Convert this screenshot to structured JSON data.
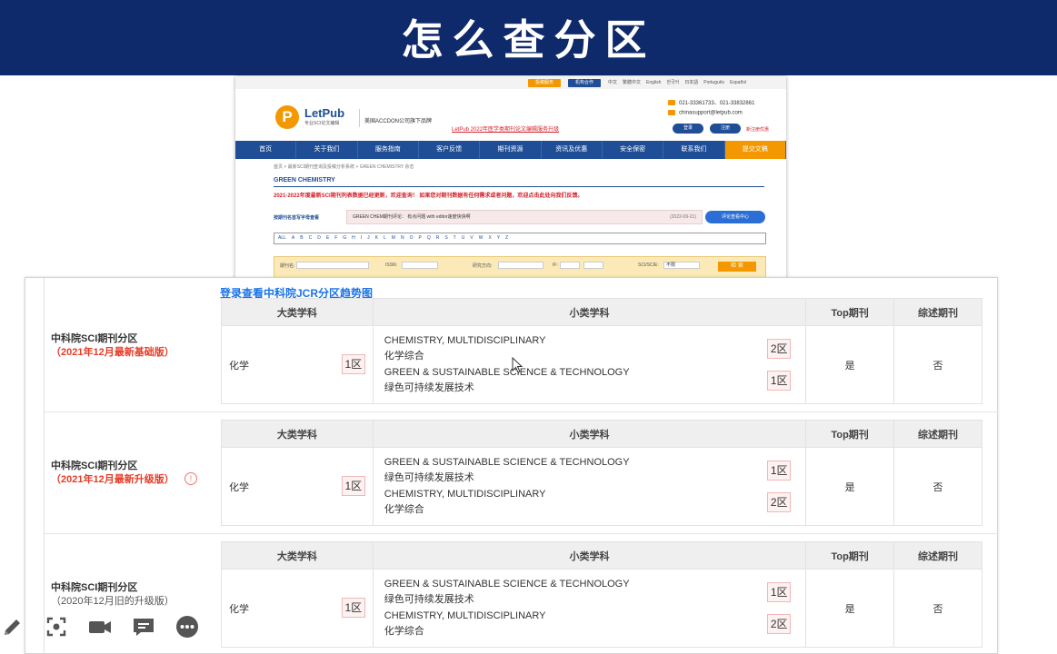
{
  "slide": {
    "title": "怎么查分区"
  },
  "letpub": {
    "top_buttons": [
      "投稿服务",
      "机构合作"
    ],
    "languages": [
      "中文",
      "繁體中文",
      "English",
      "한국어",
      "日本語",
      "Português",
      "Español"
    ],
    "logo": {
      "letter": "P",
      "name": "LetPub",
      "tagline": "专业SCI论文编辑"
    },
    "parent_company": "美国ACCDON公司旗下品牌",
    "notice": "LetPub 2022年医学类期刊论文编辑服务升级",
    "phone": "021-33361733、021-33832861",
    "email": "chinasupport@letpub.com",
    "login": "登录",
    "register": "注册",
    "new_user": "新注册优惠",
    "nav": [
      "首页",
      "关于我们",
      "服务指南",
      "客户反馈",
      "期刊资源",
      "资讯及优惠",
      "安全保密",
      "联系我们",
      "提交文稿"
    ],
    "breadcrumb": "首页 > 最新SCI期刊查询及投稿分析系统 > GREEN CHEMISTRY 杂志",
    "journal_name": "GREEN CHEMISTRY",
    "update_message": "2021-2022年度最新SCI期刊列表数据已经更新，欢迎查询！ 如果您对期刊数据有任何需求或者问题，欢迎点击此处向我们反馈。",
    "browse_label": "按期刊名首写字母查看",
    "comment_text": "GREEN CHEM期刊评论：   有点问题 with editor速度快快啊",
    "comment_date": "(2022-09-21)",
    "comment_button": "评论查看中心",
    "alphabet": [
      "ALL",
      "A",
      "B",
      "C",
      "D",
      "E",
      "F",
      "G",
      "H",
      "I",
      "J",
      "K",
      "L",
      "M",
      "N",
      "O",
      "P",
      "Q",
      "R",
      "S",
      "T",
      "U",
      "V",
      "W",
      "X",
      "Y",
      "Z"
    ],
    "search_fields": [
      "期刊名:",
      "ISSN:",
      "研究方向:",
      "IF:",
      "SCI/SCIE:"
    ],
    "search_select": "不限",
    "search_button": "检 索"
  },
  "partition": {
    "trend_link": "登录查看中科院JCR分区趋势图",
    "headers": {
      "major": "大类学科",
      "minor": "小类学科",
      "top": "Top期刊",
      "review": "综述期刊"
    },
    "sections": [
      {
        "label": "中科院SCI期刊分区",
        "edition": "（2021年12月最新基础版）",
        "major_subject": "化学",
        "major_zone": "1区",
        "minors": [
          {
            "en": "CHEMISTRY, MULTIDISCIPLINARY",
            "cn": "化学综合",
            "zone": "2区"
          },
          {
            "en": "GREEN & SUSTAINABLE SCIENCE & TECHNOLOGY",
            "cn": "绿色可持续发展技术",
            "zone": "1区"
          }
        ],
        "top": "是",
        "review": "否"
      },
      {
        "label": "中科院SCI期刊分区",
        "edition": "（2021年12月最新升级版）",
        "info_icon": "!",
        "major_subject": "化学",
        "major_zone": "1区",
        "minors": [
          {
            "en": "GREEN & SUSTAINABLE SCIENCE & TECHNOLOGY",
            "cn": "绿色可持续发展技术",
            "zone": "1区"
          },
          {
            "en": "CHEMISTRY, MULTIDISCIPLINARY",
            "cn": "化学综合",
            "zone": "2区"
          }
        ],
        "top": "是",
        "review": "否"
      },
      {
        "label": "中科院SCI期刊分区",
        "edition": "（2020年12月旧的升级版）",
        "major_subject": "化学",
        "major_zone": "1区",
        "minors": [
          {
            "en": "GREEN & SUSTAINABLE SCIENCE & TECHNOLOGY",
            "cn": "绿色可持续发展技术",
            "zone": "1区"
          },
          {
            "en": "CHEMISTRY, MULTIDISCIPLINARY",
            "cn": "化学综合",
            "zone": "2区"
          }
        ],
        "top": "是",
        "review": "否"
      }
    ]
  },
  "toolbar": {
    "icons": [
      "pencil-icon",
      "screenshot-icon",
      "camera-icon",
      "chat-icon",
      "more-icon"
    ]
  },
  "colors": {
    "banner": "#0f2a6b",
    "letpub_blue": "#1f4e96",
    "letpub_orange": "#f39800",
    "edition_red": "#e63c27",
    "link_blue": "#1a73e8"
  }
}
